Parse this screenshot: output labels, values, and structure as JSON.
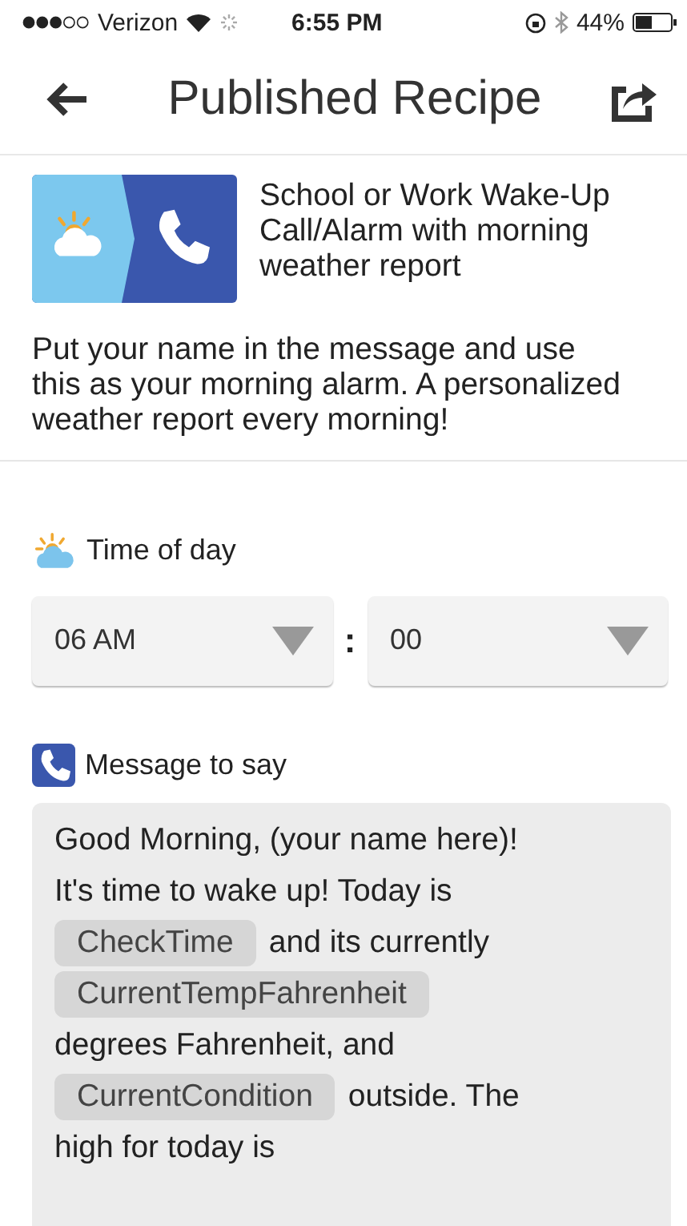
{
  "status_bar": {
    "carrier": "Verizon",
    "time": "6:55 PM",
    "battery": "44%"
  },
  "header": {
    "title": "Published Recipe"
  },
  "recipe": {
    "title": "School or Work Wake-Up Call/Alarm with morning weather report",
    "description": "Put your name in the message and use this as your morning alarm. A personalized weather report every morning!"
  },
  "time_field": {
    "label": "Time of day",
    "hour": "06 AM",
    "separator": ":",
    "minute": "00"
  },
  "message_field": {
    "label": "Message to say",
    "lines": [
      [
        {
          "kind": "text",
          "text": "Good Morning, (your name here)!"
        }
      ],
      [
        {
          "kind": "text",
          "text": "It's time to wake up! Today is"
        }
      ],
      [
        {
          "kind": "token",
          "text": "CheckTime"
        },
        {
          "kind": "text",
          "text": "and its currently"
        }
      ],
      [
        {
          "kind": "token",
          "text": "CurrentTempFahrenheit"
        }
      ],
      [
        {
          "kind": "text",
          "text": "degrees Fahrenheit, and"
        }
      ],
      [
        {
          "kind": "token",
          "text": "CurrentCondition"
        },
        {
          "kind": "text",
          "text": "outside. The"
        }
      ],
      [
        {
          "kind": "text",
          "text": "high for today is"
        }
      ]
    ]
  }
}
